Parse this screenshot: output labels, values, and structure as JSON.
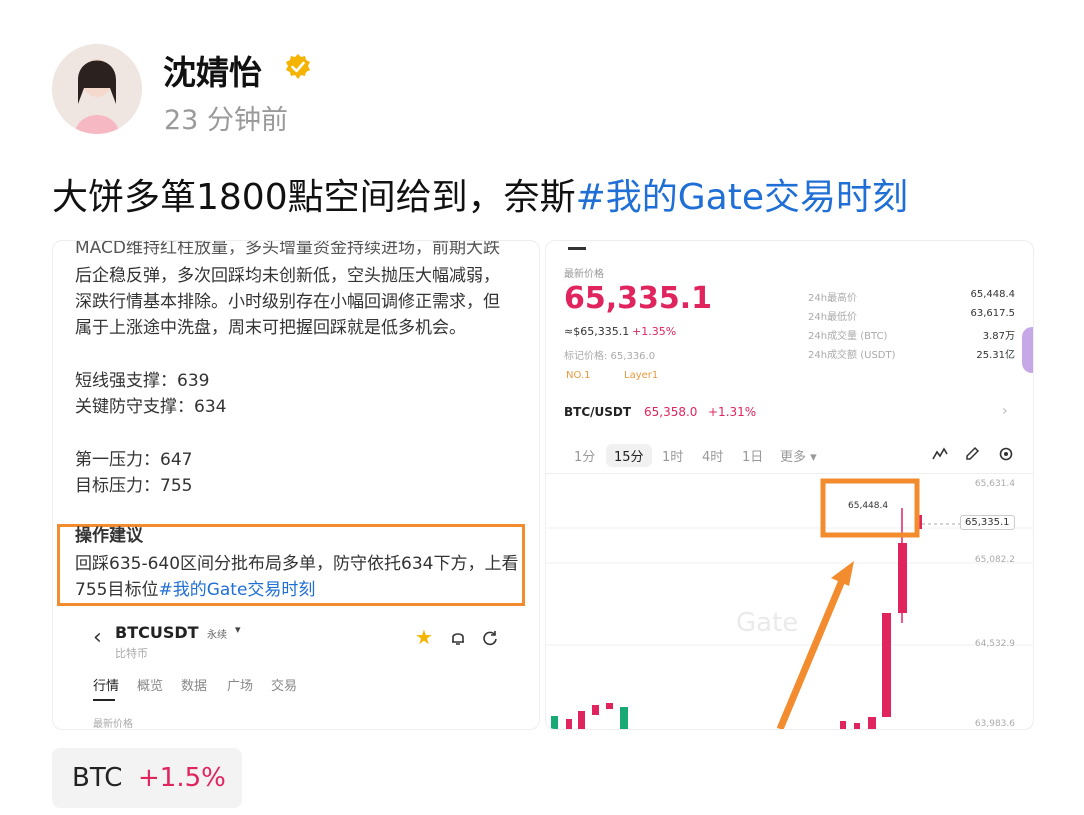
{
  "post": {
    "author": "沈婧怡",
    "time": "23 分钟前",
    "text_main": "大饼多箪1800點空间给到，奈斯",
    "text_tag": "#我的Gate交易时刻"
  },
  "left_image": {
    "lines": [
      "MACD维持红柱放量，多头增量资金持续进场，前期大跌",
      "后企稳反弹，多次回踩均未创新低，空头抛压大幅减弱，",
      "深跌行情基本排除。小时级别存在小幅回调修正需求，但",
      "属于上涨途中洗盘，周末可把握回踩就是低多机会。",
      "短线强支撑：639",
      "关键防守支撑：634",
      "第一压力：647",
      "目标压力：755",
      "操作建议",
      "回踩635-640区间分批布局多单，防守依托634下方，上看",
      "755目标位"
    ],
    "tag": "#我的Gate交易时刻",
    "app": {
      "symbol": "BTCUSDT",
      "contract": "永续",
      "subtitle": "比特币",
      "tabs": [
        "行情",
        "概览",
        "数据",
        "广场",
        "交易"
      ],
      "bottom": "最新价格"
    }
  },
  "right_image": {
    "latest_label": "最新价格",
    "price": "65,335.1",
    "fiat": "≈$65,335.1",
    "change": "+1.35%",
    "mark": "标记价格: 65,336.0",
    "badge1": "NO.1",
    "badge2": "Layer1",
    "stats": [
      {
        "label": "24h最高价",
        "value": "65,448.4"
      },
      {
        "label": "24h最低价",
        "value": "63,617.5"
      },
      {
        "label": "24h成交量 (BTC)",
        "value": "3.87万"
      },
      {
        "label": "24h成交额 (USDT)",
        "value": "25.31亿"
      }
    ],
    "pair": "BTC/USDT",
    "pair_price": "65,358.0",
    "pair_change": "+1.31%",
    "timeframes": [
      "1分",
      "15分",
      "1时",
      "4时",
      "1日",
      "更多"
    ],
    "active_timeframe": "15分",
    "axis": [
      "65,631.4",
      "65,082.2",
      "64,532.9",
      "63,983.6"
    ],
    "current_tag": "65,335.1",
    "high_label": "65,448.4",
    "watermark": "Gate"
  },
  "chip": {
    "symbol": "BTC",
    "change": "+1.5%"
  }
}
